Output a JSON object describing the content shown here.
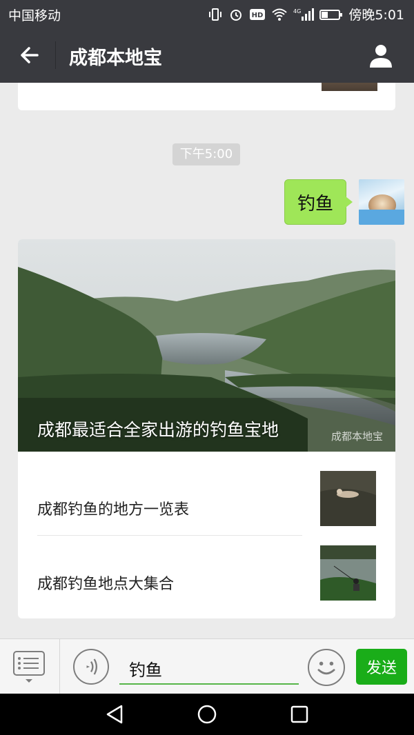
{
  "status_bar": {
    "carrier": "中国移动",
    "time": "傍晚5:01",
    "icons": [
      "vibrate-icon",
      "alarm-icon",
      "hd-icon",
      "wifi-icon",
      "4g-signal-icon",
      "battery-icon"
    ]
  },
  "header": {
    "title": "成都本地宝",
    "back_icon": "arrow-left-icon",
    "profile_icon": "person-icon"
  },
  "chat": {
    "timestamp": "下午5:00",
    "outgoing_message": "钓鱼",
    "news_card": {
      "hero_title": "成都最适合全家出游的钓鱼宝地",
      "watermark": "成都本地宝",
      "items": [
        {
          "label": "成都钓鱼的地方一览表"
        },
        {
          "label": "成都钓鱼地点大集合"
        }
      ]
    }
  },
  "input_bar": {
    "text_value": "钓鱼",
    "send_label": "发送"
  },
  "nav_bar": {
    "icons": [
      "back-triangle-icon",
      "home-circle-icon",
      "recents-square-icon"
    ]
  },
  "colors": {
    "header_bg": "#393a3f",
    "bubble_green": "#9fe658",
    "send_green": "#1aad19"
  }
}
